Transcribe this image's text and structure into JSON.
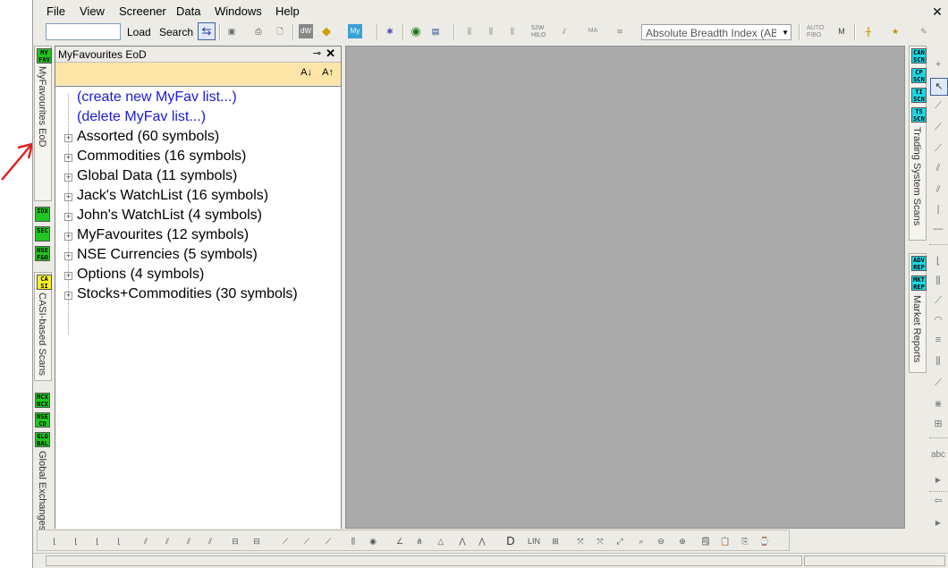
{
  "menu": [
    "File",
    "View",
    "Screener",
    "Data",
    "Windows",
    "Help"
  ],
  "toolbar": {
    "load_label": "Load",
    "search_label": "Search",
    "indicator_combo_value": "Absolute Breadth Index (ABI"
  },
  "left_strip": {
    "myfav_badge": "MY FAV",
    "myfav_tab_label": "MyFavourites EoD",
    "idx_badge": "IDX",
    "sec_badge": "SEC",
    "nsefao_badge": "NSE F&O",
    "casi_badge": "CA SI",
    "casi_tab_label": "CASI-based Scans",
    "mcxncx_badge": "MCX NCX",
    "nsecd_badge": "NSE CD",
    "global_badge": "GLO BAL",
    "global_tab_label": "Global Exchanges"
  },
  "panel": {
    "title": "MyFavourites EoD",
    "sort_asc": "A↓",
    "sort_desc": "A↑",
    "actions": [
      "(create new MyFav list...)",
      "(delete MyFav list...)"
    ],
    "lists": [
      "Assorted (60 symbols)",
      "Commodities (16 symbols)",
      "Global Data (11 symbols)",
      "Jack's WatchList (16 symbols)",
      "John's WatchList (4 symbols)",
      "MyFavourites (12 symbols)",
      "NSE Currencies (5 symbols)",
      "Options (4 symbols)",
      "Stocks+Commodities (30 symbols)"
    ]
  },
  "right_strip": {
    "can_badge": "CAN SCN",
    "cp_badge": "CP SCN",
    "ti_badge": "TI SCN",
    "ts_badge": "TS SCN",
    "scans_tab_label": "Trading System Scans",
    "adv_badge": "ADV REP",
    "mkt_badge": "MKT REP",
    "reports_tab_label": "Market Reports",
    "abc_label": "abc"
  },
  "bottom_toolbar": {
    "lin_label": "LIN"
  },
  "colors": {
    "accent_orange": "#fde5a8",
    "link_blue": "#1a1ad8",
    "badge_green": "#22c322",
    "badge_yellow": "#f6f02a",
    "badge_cyan": "#1cd8e6",
    "annotation_arrow": "#e02020"
  }
}
